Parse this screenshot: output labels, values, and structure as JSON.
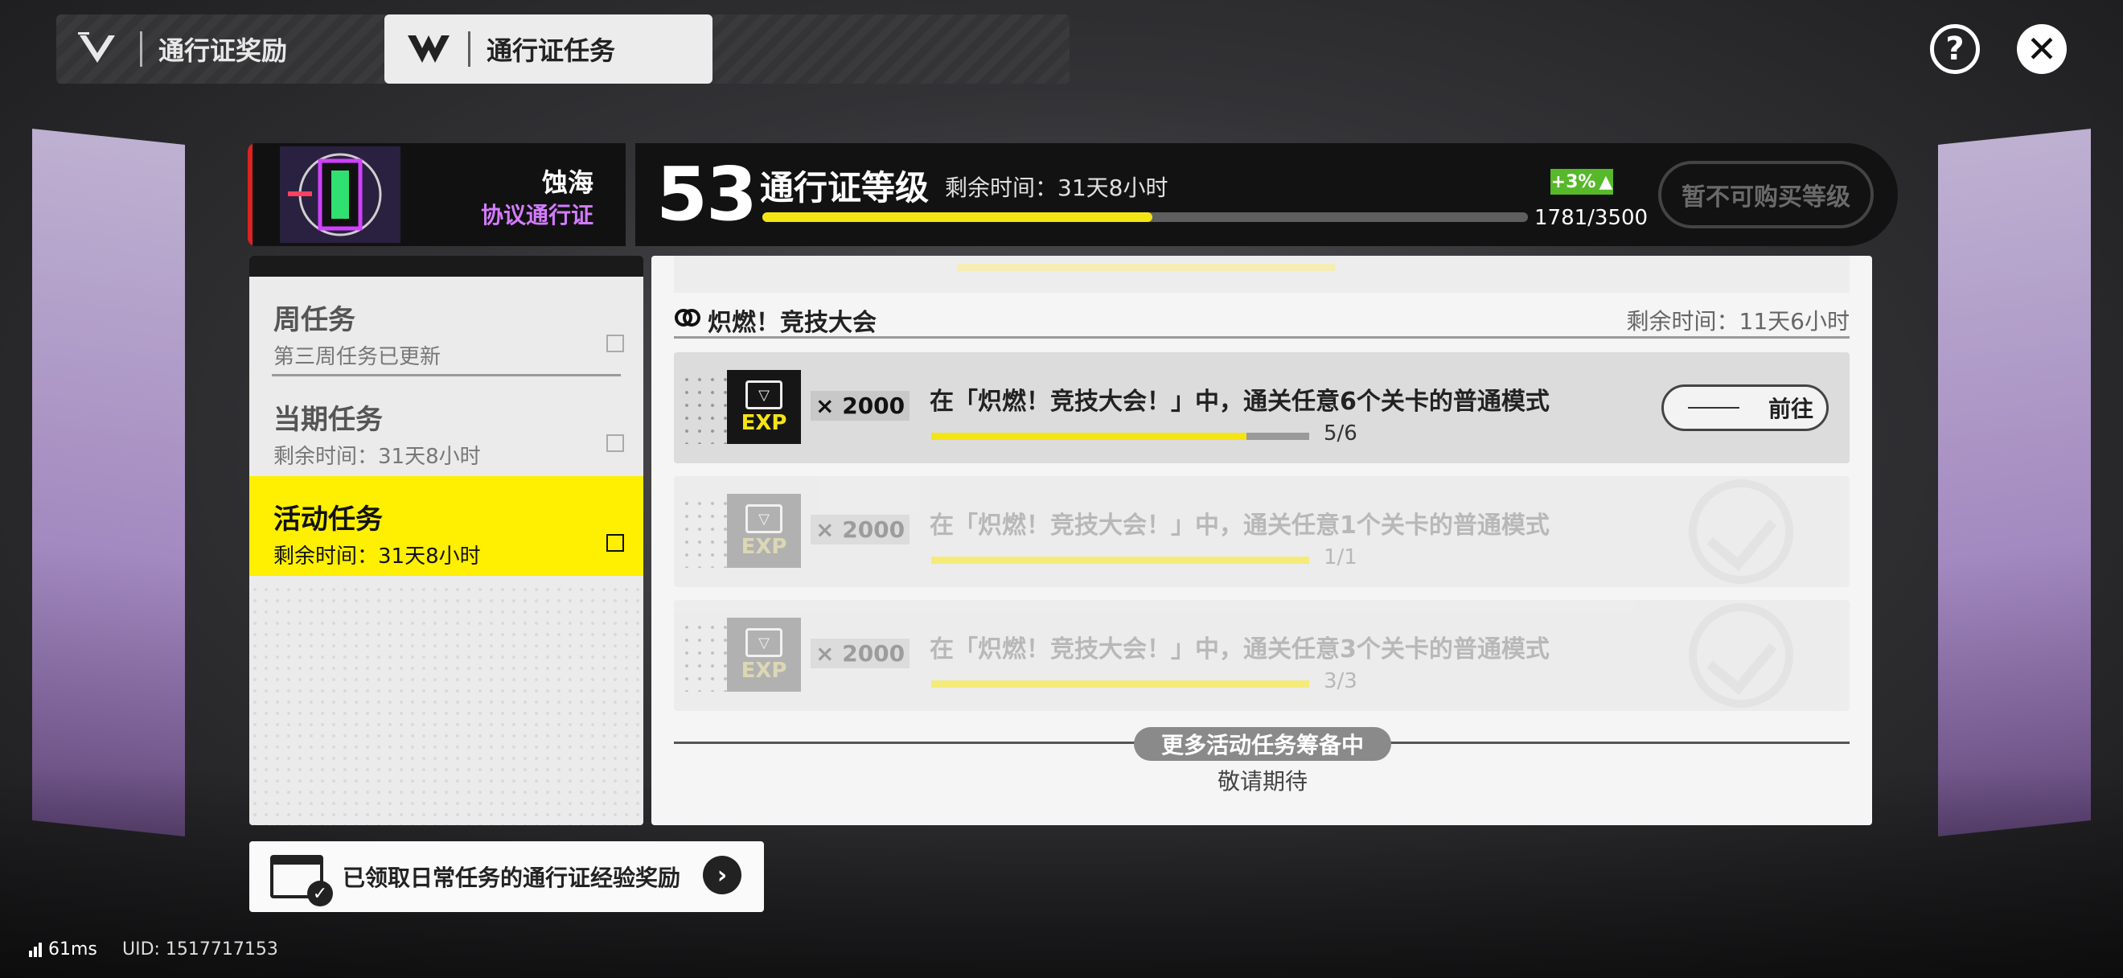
{
  "tabs": {
    "rewards_label": "通行证奖励",
    "quests_label": "通行证任务"
  },
  "pass": {
    "name": "蚀海",
    "type": "协议通行证",
    "level": "53",
    "level_title": "通行证等级",
    "remaining": "剩余时间：31天8小时",
    "exp": "1781/3500",
    "exp_fraction": 0.509,
    "bonus": "+3%",
    "buy_label": "暂不可购买等级"
  },
  "categories": [
    {
      "title": "周任务",
      "sub": "第三周任务已更新",
      "active": false
    },
    {
      "title": "当期任务",
      "sub": "剩余时间：31天8小时",
      "active": false
    },
    {
      "title": "活动任务",
      "sub": "剩余时间：31天8小时",
      "active": true
    }
  ],
  "event": {
    "title": "炽燃！竞技大会",
    "remaining": "剩余时间：11天6小时"
  },
  "missions": [
    {
      "qty": "× 2000",
      "exp_label": "EXP",
      "desc": "在「炽燃！竞技大会！」中，通关任意6个关卡的普通模式",
      "progress": "5/6",
      "fraction": 0.8333,
      "completed": false,
      "button": "前往"
    },
    {
      "qty": "× 2000",
      "exp_label": "EXP",
      "desc": "在「炽燃！竞技大会！」中，通关任意1个关卡的普通模式",
      "progress": "1/1",
      "fraction": 1.0,
      "completed": true
    },
    {
      "qty": "× 2000",
      "exp_label": "EXP",
      "desc": "在「炽燃！竞技大会！」中，通关任意3个关卡的普通模式",
      "progress": "3/3",
      "fraction": 1.0,
      "completed": true
    }
  ],
  "more": {
    "label": "更多活动任务筹备中",
    "sub": "敬请期待"
  },
  "daily": {
    "text": "已领取日常任务的通行证经验奖励"
  },
  "status": {
    "ping": "61ms",
    "uid": "UID: 1517717153"
  },
  "colors": {
    "accent_yellow": "#ffef00",
    "pass_purple": "#d37bff",
    "bonus_green": "#57b82a"
  }
}
